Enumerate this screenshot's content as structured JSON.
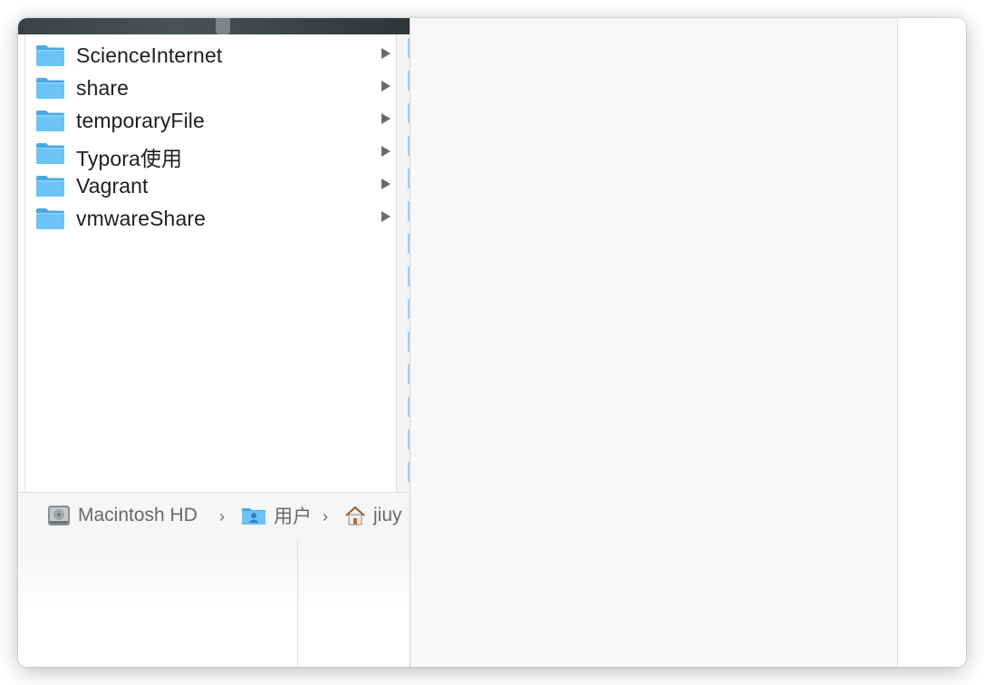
{
  "folders": [
    {
      "name": "ScienceInternet",
      "icon": "folder-icon"
    },
    {
      "name": "share",
      "icon": "folder-icon"
    },
    {
      "name": "temporaryFile",
      "icon": "folder-icon"
    },
    {
      "name": "Typora使用",
      "icon": "folder-icon"
    },
    {
      "name": "Vagrant",
      "icon": "folder-icon"
    },
    {
      "name": "vmwareShare",
      "icon": "folder-icon"
    }
  ],
  "pathbar": {
    "disk": {
      "label": "Macintosh HD",
      "icon": "hard-drive-icon"
    },
    "users": {
      "label": "用户",
      "icon": "users-folder-icon"
    },
    "home": {
      "label": "jiuy",
      "icon": "home-icon"
    },
    "separator": "›"
  },
  "colors": {
    "folder_blue": "#6cc3f5",
    "folder_blue_dark": "#4aa8e6",
    "text": "#1f1f1f",
    "muted_text": "#6a6a6a"
  }
}
